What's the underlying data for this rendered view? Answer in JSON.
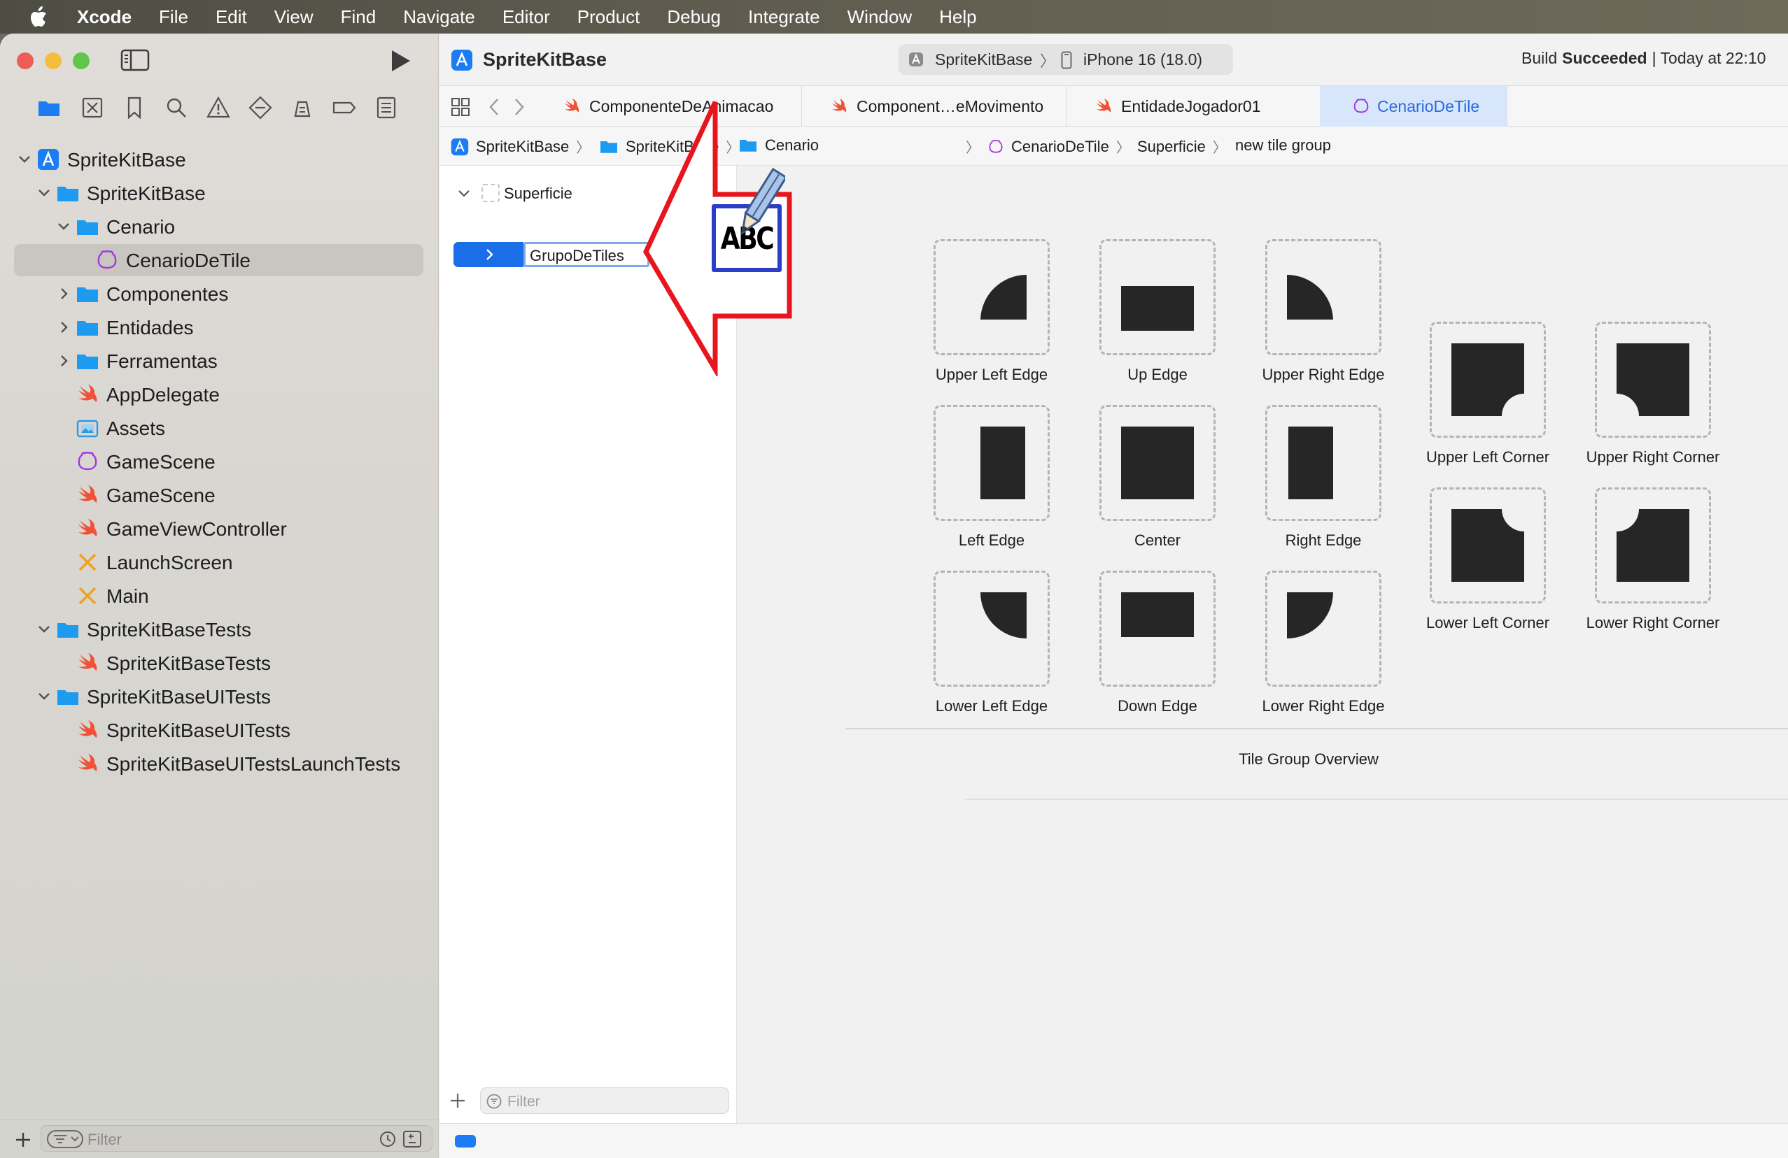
{
  "menubar": {
    "app_name": "Xcode",
    "items": [
      "File",
      "Edit",
      "View",
      "Find",
      "Navigate",
      "Editor",
      "Product",
      "Debug",
      "Integrate",
      "Window",
      "Help"
    ]
  },
  "toolbar": {
    "project_title": "SpriteKitBase",
    "scheme": "SpriteKitBase",
    "destination": "iPhone 16 (18.0)",
    "build_status_prefix": "Build",
    "build_status_result": "Succeeded",
    "build_time": "| Today at 22:10"
  },
  "navigator": {
    "items": [
      {
        "label": "SpriteKitBase",
        "icon": "project-icon"
      },
      {
        "label": "SpriteKitBase",
        "icon": "folder-icon"
      },
      {
        "label": "Cenario",
        "icon": "folder-icon"
      },
      {
        "label": "CenarioDeTile",
        "icon": "tileset-icon"
      },
      {
        "label": "Componentes",
        "icon": "folder-icon"
      },
      {
        "label": "Entidades",
        "icon": "folder-icon"
      },
      {
        "label": "Ferramentas",
        "icon": "folder-icon"
      },
      {
        "label": "AppDelegate",
        "icon": "swift-icon"
      },
      {
        "label": "Assets",
        "icon": "assets-icon"
      },
      {
        "label": "GameScene",
        "icon": "scene-icon"
      },
      {
        "label": "GameScene",
        "icon": "swift-icon"
      },
      {
        "label": "GameViewController",
        "icon": "swift-icon"
      },
      {
        "label": "LaunchScreen",
        "icon": "storyboard-icon"
      },
      {
        "label": "Main",
        "icon": "storyboard-icon"
      },
      {
        "label": "SpriteKitBaseTests",
        "icon": "folder-icon"
      },
      {
        "label": "SpriteKitBaseTests",
        "icon": "swift-icon"
      },
      {
        "label": "SpriteKitBaseUITests",
        "icon": "folder-icon"
      },
      {
        "label": "SpriteKitBaseUITests",
        "icon": "swift-icon"
      },
      {
        "label": "SpriteKitBaseUITestsLaunchTests",
        "icon": "swift-icon"
      }
    ],
    "filter_placeholder": "Filter"
  },
  "tabs": [
    {
      "label": "ComponenteDeAnimacao"
    },
    {
      "label": "Component…eMovimento"
    },
    {
      "label": "EntidadeJogador01"
    },
    {
      "label": "CenarioDeTile"
    }
  ],
  "jumpbar": {
    "crumbs": [
      "SpriteKitBase",
      "SpriteKitBase",
      "Cenario",
      "CenarioDeTile",
      "Superficie",
      "new tile group"
    ]
  },
  "outline": {
    "parent": "Superficie",
    "editing_value": "GrupoDeTiles",
    "filter_placeholder": "Filter"
  },
  "tile_group": {
    "tiles": [
      "Upper Left Edge",
      "Up Edge",
      "Upper Right Edge",
      "Left Edge",
      "Center",
      "Right Edge",
      "Lower Left Edge",
      "Down Edge",
      "Lower Right Edge"
    ],
    "corners": [
      "Upper Left Corner",
      "Upper Right Corner",
      "Lower Left Corner",
      "Lower Right Corner"
    ],
    "overview_label": "Tile Group Overview"
  },
  "overlay": {
    "rename_icon_text": "ABC"
  }
}
